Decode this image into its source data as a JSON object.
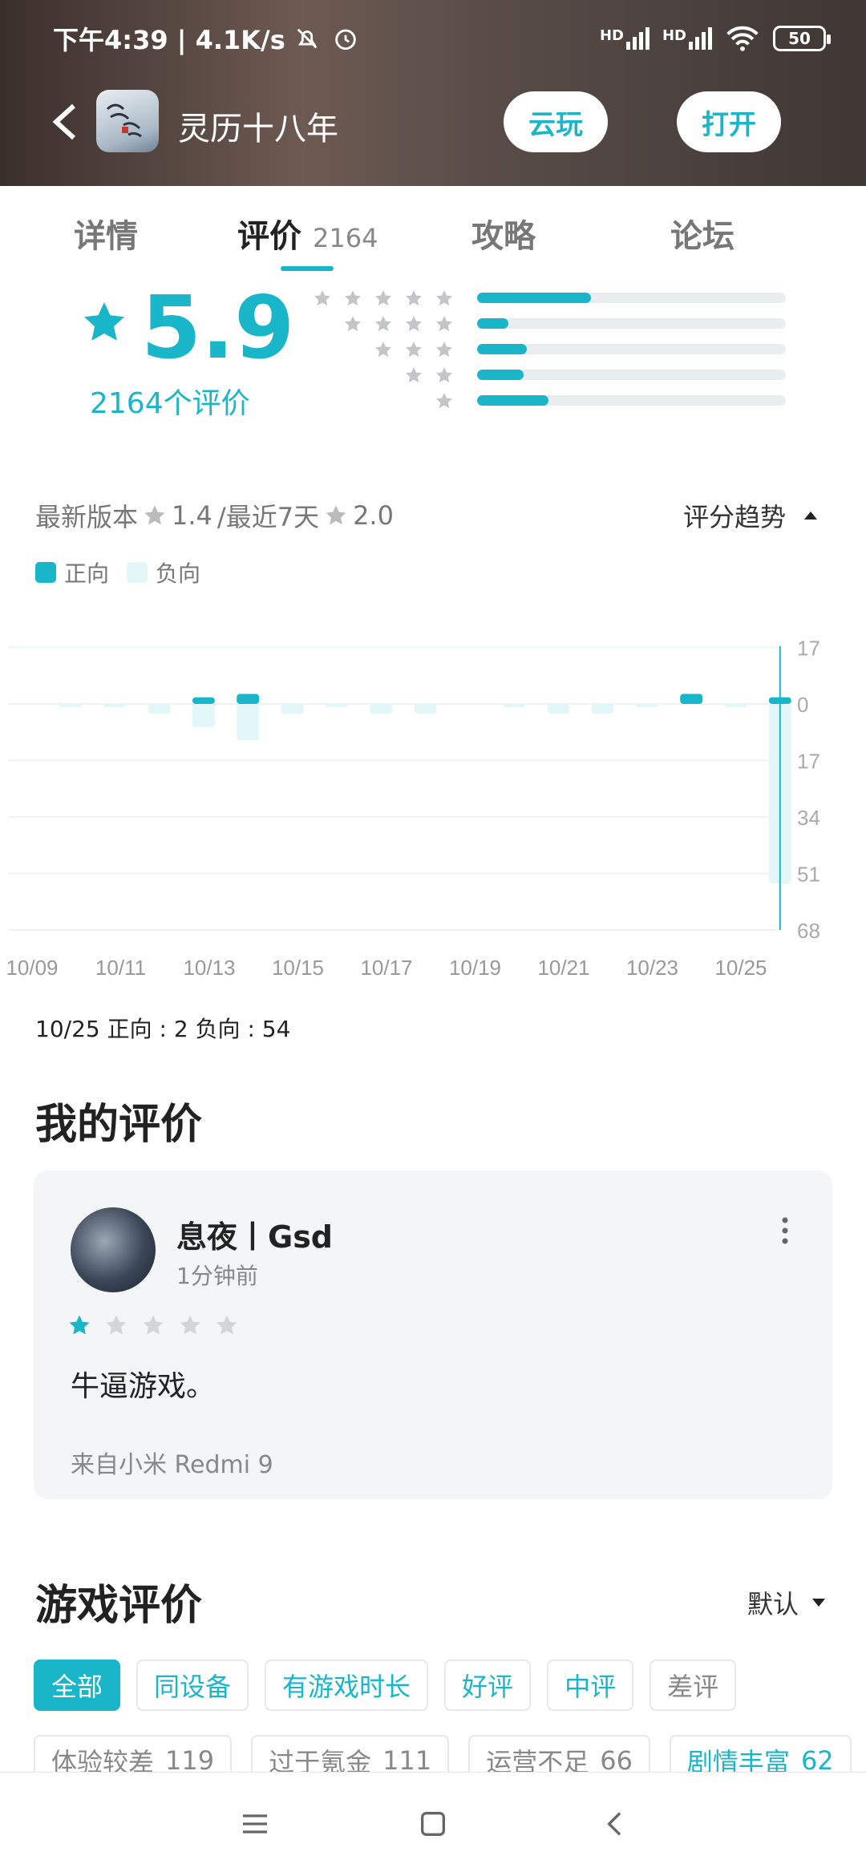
{
  "status_bar": {
    "time": "下午4:39 | 4.1K/s",
    "net1": "HD",
    "net2": "HD",
    "battery": "50"
  },
  "app": {
    "title": "灵历十八年",
    "cloud_play": "云玩",
    "open": "打开"
  },
  "tabs": [
    {
      "label": "详情"
    },
    {
      "label": "评价",
      "count": "2164"
    },
    {
      "label": "攻略"
    },
    {
      "label": "论坛"
    }
  ],
  "rating": {
    "score": "5.9",
    "count_label": "2164个评价",
    "distribution": [
      {
        "stars": 5,
        "fraction": 0.37
      },
      {
        "stars": 4,
        "fraction": 0.1
      },
      {
        "stars": 3,
        "fraction": 0.16
      },
      {
        "stars": 2,
        "fraction": 0.15
      },
      {
        "stars": 1,
        "fraction": 0.23
      }
    ]
  },
  "version_line": {
    "latest_label": "最新版本",
    "latest_score": "1.4",
    "recent_label": "/最近7天",
    "recent_score": "2.0",
    "trend_label": "评分趋势"
  },
  "legend": {
    "positive": "正向",
    "negative": "负向"
  },
  "chart_data": {
    "type": "bar",
    "x_labels": [
      "10/09",
      "10/11",
      "10/13",
      "10/15",
      "10/17",
      "10/19",
      "10/21",
      "10/23",
      "10/25"
    ],
    "y_labels": [
      "17",
      "0",
      "17",
      "34",
      "51",
      "68"
    ],
    "dates": [
      "10/09",
      "10/10",
      "10/11",
      "10/12",
      "10/13",
      "10/14",
      "10/15",
      "10/16",
      "10/17",
      "10/18",
      "10/19",
      "10/20",
      "10/21",
      "10/22",
      "10/23",
      "10/24",
      "10/25"
    ],
    "series": [
      {
        "name": "正向",
        "values": [
          0,
          0,
          0,
          2,
          3,
          0,
          0,
          0,
          0,
          0,
          0,
          0,
          0,
          0,
          3,
          0,
          2
        ]
      },
      {
        "name": "负向",
        "values": [
          1,
          1,
          3,
          7,
          11,
          3,
          1,
          3,
          3,
          0,
          1,
          3,
          3,
          1,
          0,
          1,
          54
        ]
      }
    ],
    "ylim_pos": [
      0,
      17
    ],
    "ylim_neg": [
      0,
      68
    ],
    "selected_index": 16,
    "colors": {
      "positive": "#19b6c9",
      "negative": "#e3f7f9"
    }
  },
  "selected_note": "10/25 正向 : 2  负向 : 54",
  "my_review": {
    "section_title": "我的评价",
    "username": "息夜丨Gsd",
    "time": "1分钟前",
    "stars": 1,
    "text": "牛逼游戏。",
    "device": "来自小米 Redmi 9"
  },
  "game_reviews": {
    "section_title": "游戏评价",
    "sort": "默认",
    "filters": [
      "全部",
      "同设备",
      "有游戏时长",
      "好评",
      "中评",
      "差评"
    ],
    "tags": [
      {
        "label": "体验较差",
        "count": "119"
      },
      {
        "label": "过于氪金",
        "count": "111"
      },
      {
        "label": "运营不足",
        "count": "66"
      },
      {
        "label": "剧情丰富",
        "count": "62"
      }
    ]
  },
  "colors": {
    "accent": "#19b6c9"
  }
}
